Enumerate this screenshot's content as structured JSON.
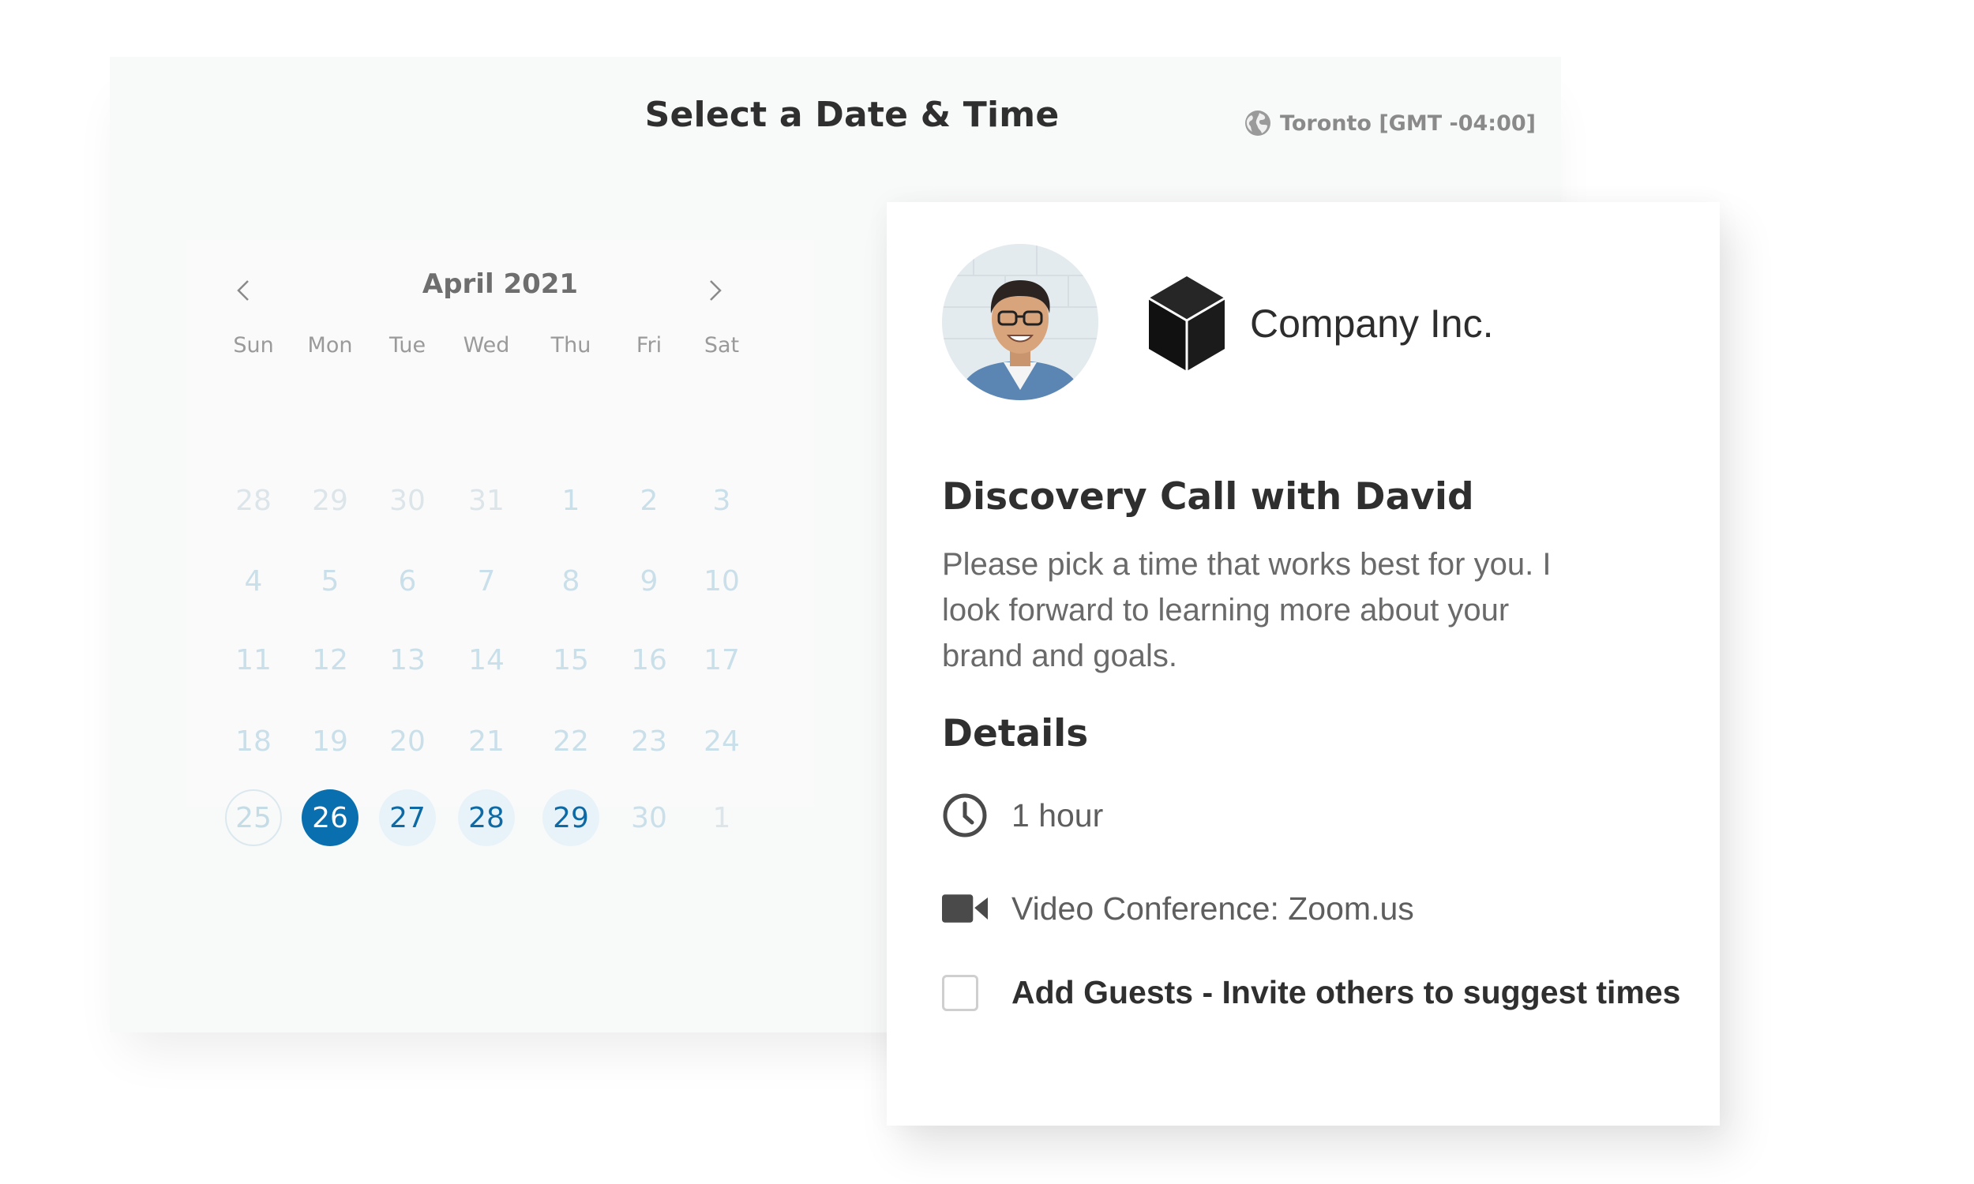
{
  "header": {
    "title": "Select a Date & Time",
    "timezone": "Toronto [GMT -04:00]",
    "timezone_icon": "globe-icon"
  },
  "calendar": {
    "month_label": "April 2021",
    "prev_icon": "chevron-left-icon",
    "next_icon": "chevron-right-icon",
    "weekdays": [
      "Sun",
      "Mon",
      "Tue",
      "Wed",
      "Thu",
      "Fri",
      "Sat"
    ],
    "weeks": [
      [
        {
          "label": "28",
          "state": "muted"
        },
        {
          "label": "29",
          "state": "muted"
        },
        {
          "label": "30",
          "state": "muted"
        },
        {
          "label": "31",
          "state": "muted"
        },
        {
          "label": "1",
          "state": "past"
        },
        {
          "label": "2",
          "state": "past"
        },
        {
          "label": "3",
          "state": "past"
        }
      ],
      [
        {
          "label": "4",
          "state": "past"
        },
        {
          "label": "5",
          "state": "past"
        },
        {
          "label": "6",
          "state": "past"
        },
        {
          "label": "7",
          "state": "past"
        },
        {
          "label": "8",
          "state": "past"
        },
        {
          "label": "9",
          "state": "past"
        },
        {
          "label": "10",
          "state": "past"
        }
      ],
      [
        {
          "label": "11",
          "state": "past"
        },
        {
          "label": "12",
          "state": "past"
        },
        {
          "label": "13",
          "state": "past"
        },
        {
          "label": "14",
          "state": "past"
        },
        {
          "label": "15",
          "state": "past"
        },
        {
          "label": "16",
          "state": "past"
        },
        {
          "label": "17",
          "state": "past"
        }
      ],
      [
        {
          "label": "18",
          "state": "past"
        },
        {
          "label": "19",
          "state": "past"
        },
        {
          "label": "20",
          "state": "past"
        },
        {
          "label": "21",
          "state": "past"
        },
        {
          "label": "22",
          "state": "past"
        },
        {
          "label": "23",
          "state": "past"
        },
        {
          "label": "24",
          "state": "past"
        }
      ],
      [
        {
          "label": "25",
          "state": "today"
        },
        {
          "label": "26",
          "state": "selected"
        },
        {
          "label": "27",
          "state": "available"
        },
        {
          "label": "28",
          "state": "available"
        },
        {
          "label": "29",
          "state": "available"
        },
        {
          "label": "30",
          "state": "past"
        },
        {
          "label": "1",
          "state": "muted"
        }
      ]
    ]
  },
  "event": {
    "avatar_icon": "person-avatar",
    "company_logo_icon": "cube-logo-icon",
    "company_name": "Company Inc.",
    "title": "Discovery Call with David",
    "description": "Please pick a time that works best for you. I look forward to learning more about your brand and goals.",
    "details_heading": "Details",
    "duration_icon": "clock-icon",
    "duration": "1 hour",
    "location_icon": "video-camera-icon",
    "location": "Video Conference: Zoom.us",
    "guests_label": "Add Guests - Invite others to suggest times",
    "guests_checked": false
  },
  "colors": {
    "accent": "#0a6fae",
    "available_bg": "#e8f3f9",
    "panel_bg": "#f8f9f9"
  }
}
